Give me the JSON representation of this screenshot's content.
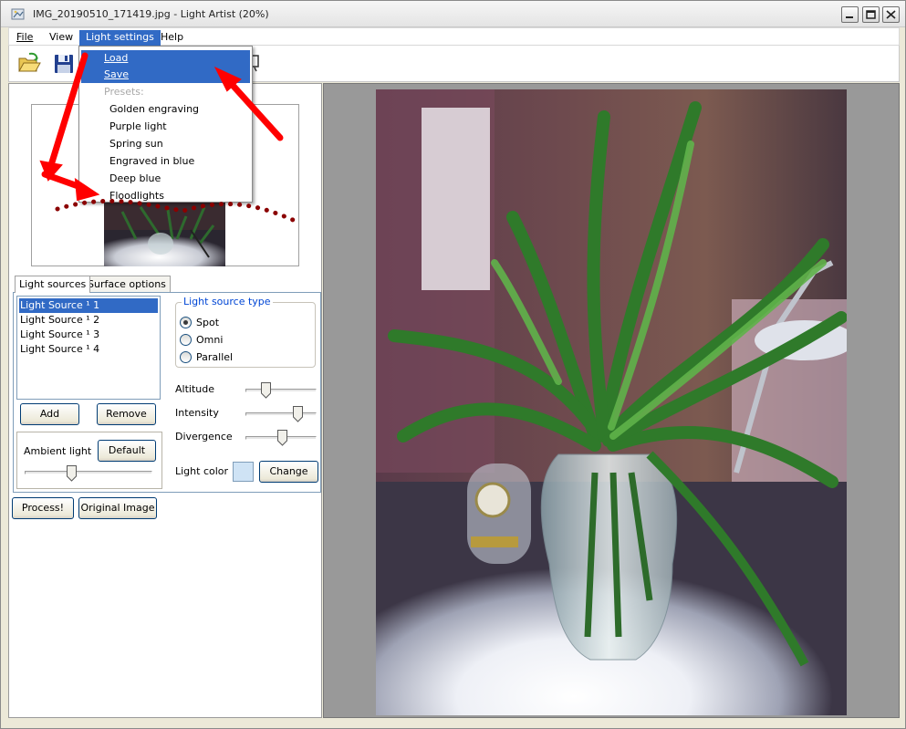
{
  "window": {
    "title": "IMG_20190510_171419.jpg - Light Artist (20%)",
    "buttons": [
      "minimize",
      "maximize",
      "close"
    ]
  },
  "menubar": {
    "items": [
      {
        "label": "File"
      },
      {
        "label": "View"
      },
      {
        "label": "Light settings"
      },
      {
        "label": "Help"
      }
    ]
  },
  "toolbar": {
    "buttons": [
      {
        "name": "open-folder-icon"
      },
      {
        "name": "save-floppy-icon"
      }
    ]
  },
  "dropdown": {
    "items": [
      {
        "label": "Load",
        "state": "highlighted"
      },
      {
        "label": "Save",
        "state": "highlighted"
      },
      {
        "label": "Presets:",
        "state": "disabled"
      },
      {
        "label": "Golden engraving"
      },
      {
        "label": "Purple light"
      },
      {
        "label": "Spring sun"
      },
      {
        "label": "Engraved in blue"
      },
      {
        "label": "Deep blue"
      },
      {
        "label": "Floodlights"
      }
    ]
  },
  "tabs": {
    "light_sources": "Light sources",
    "surface_options": "Surface options"
  },
  "light_sources": {
    "items": [
      "Light Source ¹ 1",
      "Light Source ¹ 2",
      "Light Source ¹ 3",
      "Light Source ¹ 4"
    ],
    "selected_index": 0,
    "add_label": "Add",
    "remove_label": "Remove"
  },
  "ambient": {
    "label": "Ambient light",
    "default_label": "Default",
    "level": 0.36
  },
  "light_source_type": {
    "title": "Light source type",
    "options": [
      "Spot",
      "Omni",
      "Parallel"
    ],
    "selected": "Spot"
  },
  "params": {
    "altitude_label": "Altitude",
    "altitude_level": 0.25,
    "intensity_label": "Intensity",
    "intensity_level": 0.78,
    "divergence_label": "Divergence",
    "divergence_level": 0.52,
    "light_color_label": "Light color",
    "light_color": "#cfe3f5",
    "change_label": "Change"
  },
  "actions": {
    "process_label": "Process!",
    "original_label": "Original Image"
  },
  "colors": {
    "selection": "#316ac5",
    "annotation_arrow": "#ff0000",
    "annotation_dots": "#8b0000"
  }
}
